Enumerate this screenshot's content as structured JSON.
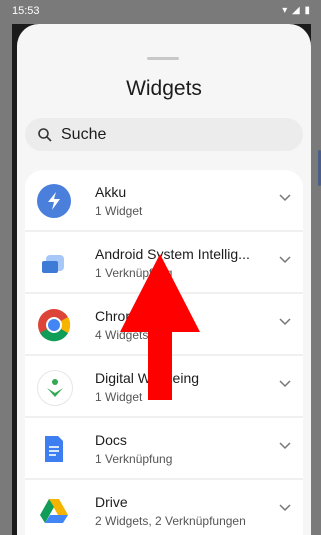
{
  "status_bar": {
    "time": "15:53",
    "icons": [
      "wifi-icon",
      "signal-icon",
      "battery-icon"
    ]
  },
  "sheet": {
    "title": "Widgets"
  },
  "search": {
    "placeholder": "Suche",
    "icon": "search-icon"
  },
  "items": [
    {
      "name": "Akku",
      "sub": "1 Widget",
      "icon": "battery-bolt-icon",
      "color": "#4a7fdc"
    },
    {
      "name": "Android System Intellig...",
      "sub": "1 Verknüpfung",
      "icon": "asi-icon",
      "color": "#3e7bd6"
    },
    {
      "name": "Chrome",
      "sub": "4 Widgets",
      "icon": "chrome-icon",
      "color": "#4285f4"
    },
    {
      "name": "Digital Wellbeing",
      "sub": "1 Widget",
      "icon": "wellbeing-icon",
      "color": "#34a853"
    },
    {
      "name": "Docs",
      "sub": "1 Verknüpfung",
      "icon": "docs-icon",
      "color": "#3d7ef0"
    },
    {
      "name": "Drive",
      "sub": "2 Widgets, 2 Verknüpfungen",
      "icon": "drive-icon",
      "color": "#34a853"
    }
  ],
  "overlay": {
    "arrow_color": "#ff0000"
  }
}
